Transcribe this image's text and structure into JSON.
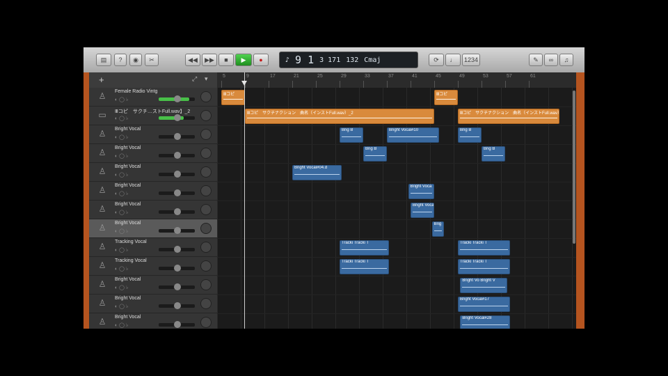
{
  "toolbar": {
    "library_icon": "library-icon",
    "help_label": "?",
    "smart_icon": "smart-controls-icon",
    "scissors_label": "✂",
    "rewind_label": "◀◀",
    "forward_label": "▶▶",
    "stop_label": "■",
    "play_label": "▶",
    "record_label": "●",
    "lcd": {
      "position": "9 1",
      "sub": "3 171",
      "tempo": "132",
      "key": "Cmaj"
    },
    "cycle_label": "⟳",
    "tuner_label": "♩",
    "count_label": "1234",
    "notes_icon": "notes-icon",
    "loops_icon": "loops-icon",
    "browser_icon": "media-browser-icon"
  },
  "header": {
    "add_label": "+"
  },
  "ruler": {
    "marks": [
      "5",
      "9",
      "17",
      "21",
      "25",
      "29",
      "33",
      "37",
      "41",
      "45",
      "49",
      "53",
      "57",
      "61"
    ]
  },
  "tracks": [
    {
      "name": "Female Radio Vintg",
      "icon": "microphone-icon",
      "meter": 0.85,
      "selected": false
    },
    {
      "name": "Ⅲコピ　サクチ…ストFull.wav】_2",
      "icon": "audio-file-icon",
      "meter": 0.7,
      "selected": false
    },
    {
      "name": "Bright Vocal",
      "icon": "microphone-icon",
      "meter": 0,
      "selected": false
    },
    {
      "name": "Bright Vocal",
      "icon": "microphone-icon",
      "meter": 0,
      "selected": false
    },
    {
      "name": "Bright Vocal",
      "icon": "microphone-icon",
      "meter": 0,
      "selected": false
    },
    {
      "name": "Bright Vocal",
      "icon": "microphone-icon",
      "meter": 0,
      "selected": false
    },
    {
      "name": "Bright Vocal",
      "icon": "microphone-icon",
      "meter": 0,
      "selected": false
    },
    {
      "name": "Bright Vocal",
      "icon": "microphone-icon",
      "meter": 0,
      "selected": true
    },
    {
      "name": "Tracking Vocal",
      "icon": "microphone-icon",
      "meter": 0,
      "selected": false
    },
    {
      "name": "Tracking Vocal",
      "icon": "microphone-icon",
      "meter": 0,
      "selected": false
    },
    {
      "name": "Bright Vocal",
      "icon": "microphone-icon",
      "meter": 0,
      "selected": false
    },
    {
      "name": "Bright Vocal",
      "icon": "microphone-icon",
      "meter": 0,
      "selected": false
    },
    {
      "name": "Bright Vocal",
      "icon": "microphone-icon",
      "meter": 0,
      "selected": false
    }
  ],
  "regions": [
    {
      "lane": 0,
      "start": 0,
      "end": 1,
      "color": "orange",
      "label": "Ⅲコピ"
    },
    {
      "lane": 0,
      "start": 9,
      "end": 10,
      "color": "orange",
      "label": "Ⅲコピ"
    },
    {
      "lane": 1,
      "start": 1,
      "end": 9,
      "color": "orange",
      "label": "Ⅲコピ　サクチナクション　曲名（インストFull.wav）_2"
    },
    {
      "lane": 1,
      "start": 10,
      "end": 14.3,
      "color": "orange",
      "label": "Ⅲコピ　サクチナクション　曲名（インストFull.wav）"
    },
    {
      "lane": 2,
      "start": 5,
      "end": 6,
      "color": "blue",
      "label": "Brig   B"
    },
    {
      "lane": 2,
      "start": 7,
      "end": 9.2,
      "color": "blue",
      "label": "Bright Vocal#10"
    },
    {
      "lane": 2,
      "start": 10,
      "end": 11,
      "color": "blue",
      "label": "Brig   B"
    },
    {
      "lane": 3,
      "start": 6,
      "end": 7,
      "color": "blue",
      "label": "Brig   B"
    },
    {
      "lane": 3,
      "start": 11,
      "end": 12,
      "color": "blue",
      "label": "Brig   B"
    },
    {
      "lane": 4,
      "start": 3,
      "end": 5.1,
      "color": "blue",
      "label": "Bright Vocal#04.d"
    },
    {
      "lane": 5,
      "start": 7.9,
      "end": 9,
      "color": "blue",
      "label": "Bright Voca"
    },
    {
      "lane": 6,
      "start": 8,
      "end": 9,
      "color": "blue",
      "label": "Bright Voca"
    },
    {
      "lane": 7,
      "start": 8.9,
      "end": 9.4,
      "color": "blue",
      "label": "Brig"
    },
    {
      "lane": 8,
      "start": 5,
      "end": 7.1,
      "color": "blue",
      "label": "Tracki  Tracki  T"
    },
    {
      "lane": 8,
      "start": 10,
      "end": 12.2,
      "color": "blue",
      "label": "Tracki  Tracki  T"
    },
    {
      "lane": 9,
      "start": 5,
      "end": 7.1,
      "color": "blue",
      "label": "Tracki  Tracki  T"
    },
    {
      "lane": 9,
      "start": 10,
      "end": 12.2,
      "color": "blue",
      "label": "Tracki  Tracki  T"
    },
    {
      "lane": 10,
      "start": 10.1,
      "end": 12.1,
      "color": "blue",
      "label": "Bright Vo  Bright V"
    },
    {
      "lane": 11,
      "start": 10,
      "end": 12.2,
      "color": "blue",
      "label": "Bright Vocal#17"
    },
    {
      "lane": 12,
      "start": 10.1,
      "end": 12.2,
      "color": "blue",
      "label": "Bright Vocal#28"
    }
  ]
}
